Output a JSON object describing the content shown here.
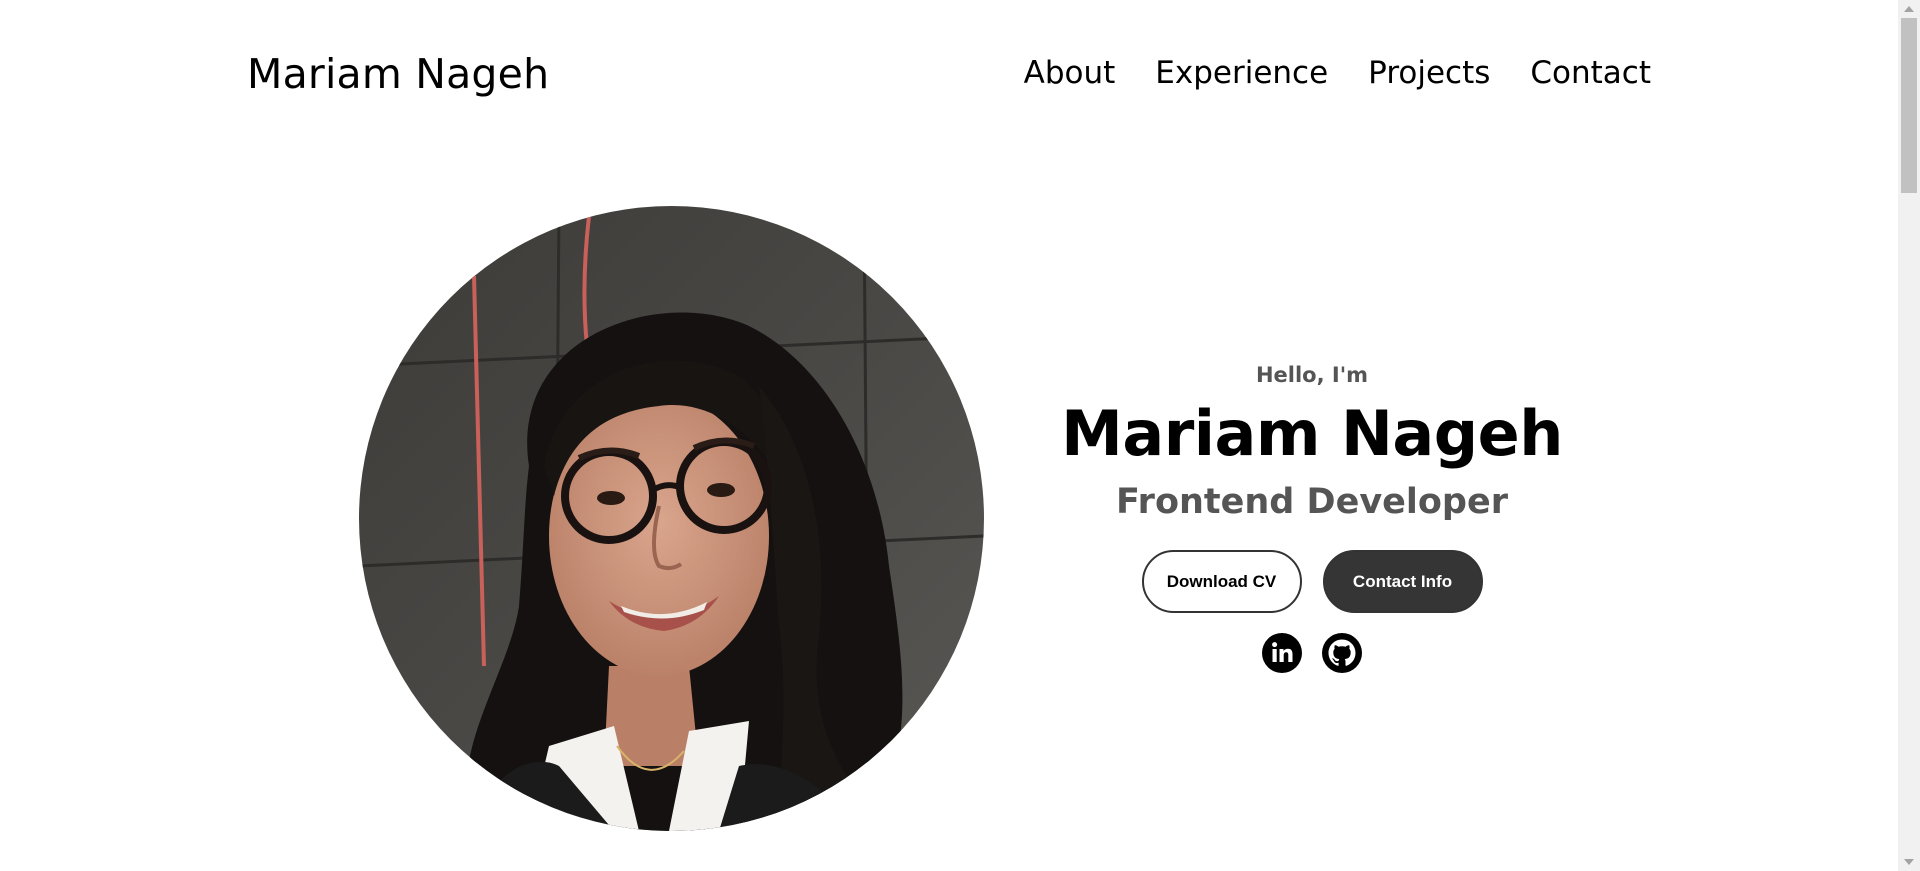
{
  "nav": {
    "logo": "Mariam Nageh",
    "links": [
      "About",
      "Experience",
      "Projects",
      "Contact"
    ]
  },
  "hero": {
    "greeting": "Hello, I'm",
    "name": "Mariam Nageh",
    "title": "Frontend Developer",
    "buttons": {
      "download_cv": "Download CV",
      "contact_info": "Contact Info"
    },
    "socials": [
      "linkedin-icon",
      "github-icon"
    ]
  },
  "colors": {
    "text_primary": "#000000",
    "text_secondary": "#555555",
    "button_dark": "#353535",
    "background": "#ffffff"
  }
}
